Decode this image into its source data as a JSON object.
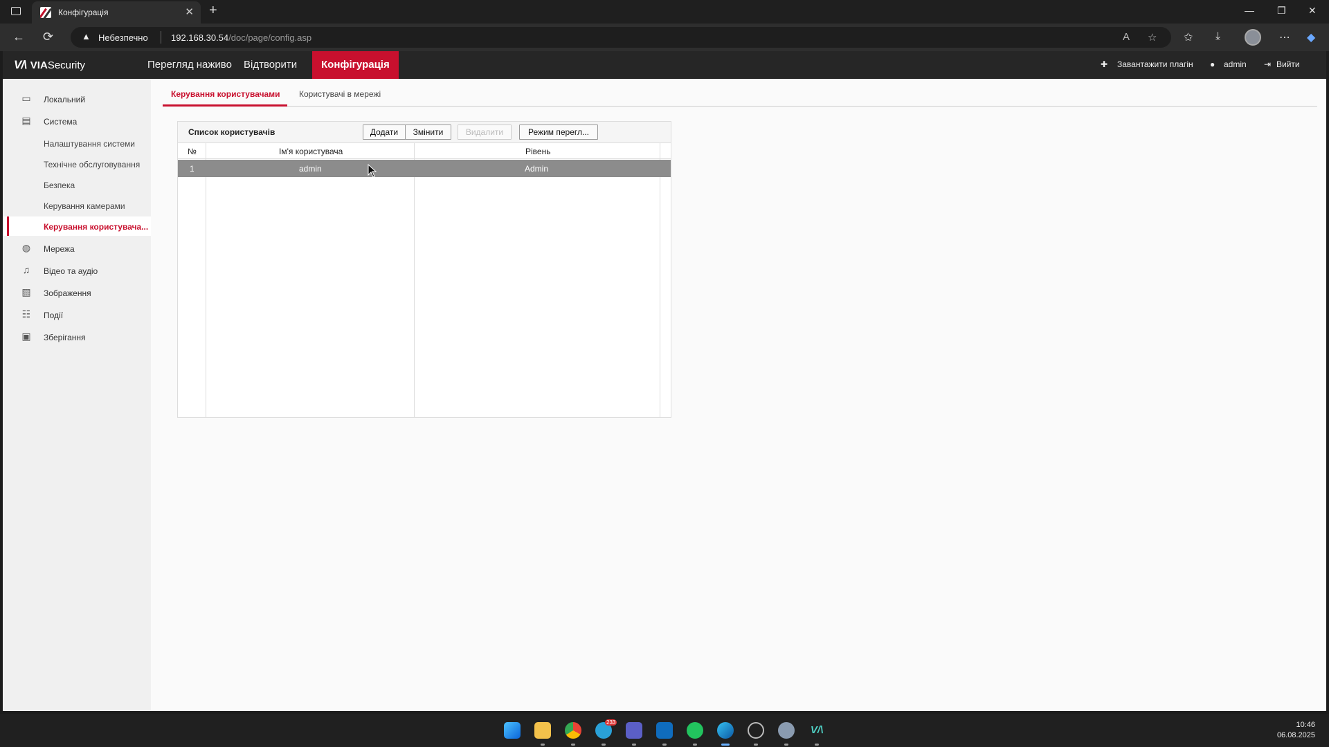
{
  "browser": {
    "tab_title": "Конфігурація",
    "tab_close": "✕",
    "new_tab": "+",
    "insecure_label": "Небезпечно",
    "url_host": "192.168.30.54",
    "url_path": "/doc/page/config.asp",
    "window_minimize": "—",
    "window_restore": "❐",
    "window_close": "✕"
  },
  "app": {
    "logo_mark": "V/\\",
    "logo_via": "VIA",
    "logo_security": "Security",
    "nav": [
      {
        "label": "Перегляд наживо"
      },
      {
        "label": "Відтворити"
      },
      {
        "label": "Конфігурація"
      }
    ],
    "download_plugin": "Завантажити плагін",
    "user": "admin",
    "logout": "Вийти"
  },
  "sidebar": {
    "items": [
      {
        "label": "Локальний",
        "icon": "monitor-icon"
      },
      {
        "label": "Система",
        "icon": "system-icon"
      },
      {
        "label": "Налаштування системи"
      },
      {
        "label": "Технічне обслуговування"
      },
      {
        "label": "Безпека"
      },
      {
        "label": "Керування камерами"
      },
      {
        "label": "Керування користувача..."
      },
      {
        "label": "Мережа",
        "icon": "globe-icon"
      },
      {
        "label": "Відео та аудіо",
        "icon": "mic-icon"
      },
      {
        "label": "Зображення",
        "icon": "image-icon"
      },
      {
        "label": "Події",
        "icon": "calendar-icon"
      },
      {
        "label": "Зберігання",
        "icon": "storage-icon"
      }
    ]
  },
  "content": {
    "tabs": [
      {
        "label": "Керування користувачами"
      },
      {
        "label": "Користувачі в мережі"
      }
    ],
    "panel_title": "Список користувачів",
    "buttons": {
      "add": "Додати",
      "modify": "Змінити",
      "delete": "Видалити",
      "view_mode": "Режим перегл..."
    },
    "columns": {
      "no": "№",
      "username": "Ім'я користувача",
      "level": "Рівень"
    },
    "rows": [
      {
        "no": "1",
        "username": "admin",
        "level": "Admin"
      }
    ]
  },
  "taskbar": {
    "time": "10:46",
    "date": "06.08.2025",
    "telegram_badge": "233"
  },
  "colors": {
    "accent": "#c8102e",
    "header_bg": "#262626",
    "selected_row": "#8c8c8c"
  }
}
